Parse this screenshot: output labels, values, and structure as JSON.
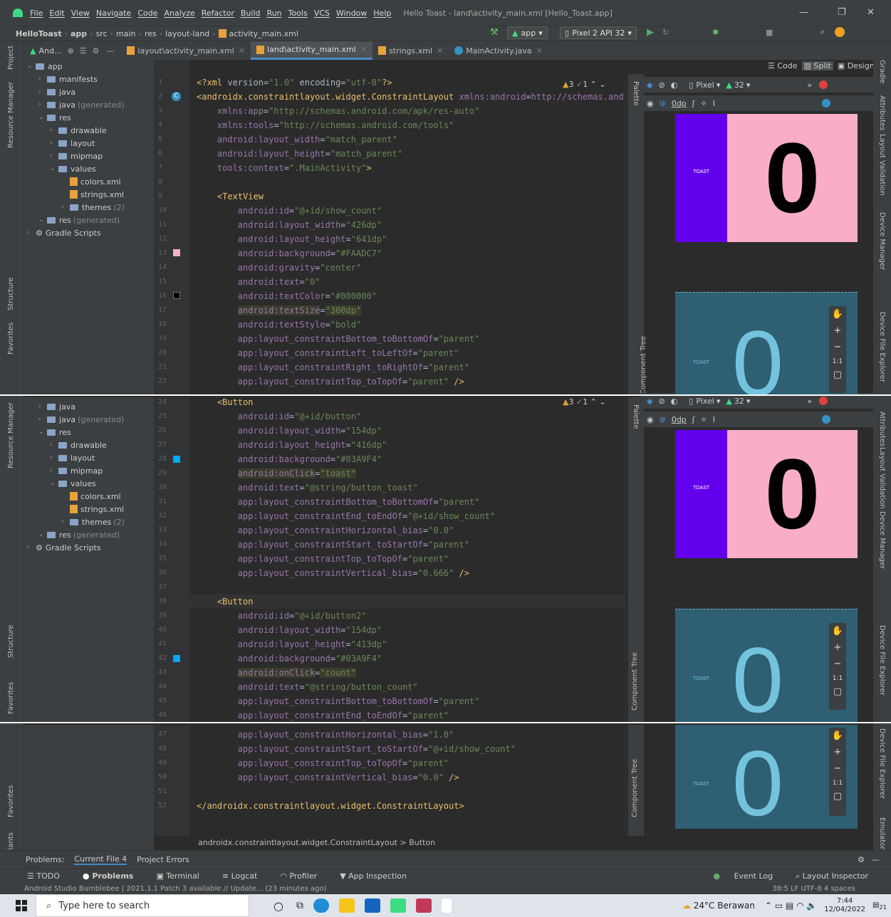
{
  "menu": {
    "items": [
      "File",
      "Edit",
      "View",
      "Navigate",
      "Code",
      "Analyze",
      "Refactor",
      "Build",
      "Run",
      "Tools",
      "VCS",
      "Window",
      "Help"
    ],
    "window_title": "Hello Toast - land\\activity_main.xml [Hello_Toast.app]"
  },
  "nav": {
    "crumbs": [
      "HelloToast",
      "app",
      "src",
      "main",
      "res",
      "layout-land",
      "activity_main.xml"
    ],
    "run_config": "app",
    "device": "Pixel 2 API 32"
  },
  "tabs": [
    "layout\\activity_main.xml",
    "land\\activity_main.xml",
    "strings.xml",
    "MainActivity.java"
  ],
  "project": {
    "header": "app",
    "view_mode": "And..."
  },
  "tree_top": [
    {
      "label": "app",
      "indent": 0
    },
    {
      "label": "manifests",
      "indent": 1
    },
    {
      "label": "java",
      "indent": 1
    },
    {
      "label": "java",
      "gen": "(generated)",
      "indent": 1
    },
    {
      "label": "res",
      "indent": 1
    },
    {
      "label": "drawable",
      "indent": 2
    },
    {
      "label": "layout",
      "indent": 2
    },
    {
      "label": "mipmap",
      "indent": 2
    },
    {
      "label": "values",
      "indent": 2
    },
    {
      "label": "colors.xml",
      "indent": 3
    },
    {
      "label": "strings.xml",
      "indent": 3
    },
    {
      "label": "themes",
      "gen": "(2)",
      "indent": 3
    },
    {
      "label": "res",
      "gen": "(generated)",
      "indent": 1
    },
    {
      "label": "Gradle Scripts",
      "indent": 0
    }
  ],
  "tree_mid": [
    {
      "label": "java",
      "indent": 1
    },
    {
      "label": "java",
      "gen": "(generated)",
      "indent": 1
    },
    {
      "label": "res",
      "indent": 1
    },
    {
      "label": "drawable",
      "indent": 2
    },
    {
      "label": "layout",
      "indent": 2
    },
    {
      "label": "mipmap",
      "indent": 2
    },
    {
      "label": "values",
      "indent": 2
    },
    {
      "label": "colors.xml",
      "indent": 3
    },
    {
      "label": "strings.xml",
      "indent": 3
    },
    {
      "label": "themes",
      "gen": "(2)",
      "indent": 3
    },
    {
      "label": "res",
      "gen": "(generated)",
      "indent": 1
    },
    {
      "label": "Gradle Scripts",
      "indent": 0
    }
  ],
  "code_top": [
    {
      "n": "1",
      "s": "<?xml version=\"1.0\" encoding=\"utf-8\"?>"
    },
    {
      "n": "2",
      "s": "<androidx.constraintlayout.widget.ConstraintLayout xmlns:android=\"http://schemas.and"
    },
    {
      "n": "3",
      "s": "    xmlns:app=\"http://schemas.android.com/apk/res-auto\""
    },
    {
      "n": "4",
      "s": "    xmlns:tools=\"http://schemas.android.com/tools\""
    },
    {
      "n": "5",
      "s": "    android:layout_width=\"match_parent\""
    },
    {
      "n": "6",
      "s": "    android:layout_height=\"match_parent\""
    },
    {
      "n": "7",
      "s": "    tools:context=\".MainActivity\">"
    },
    {
      "n": "8",
      "s": ""
    },
    {
      "n": "9",
      "s": "    <TextView"
    },
    {
      "n": "10",
      "s": "        android:id=\"@+id/show_count\""
    },
    {
      "n": "11",
      "s": "        android:layout_width=\"426dp\""
    },
    {
      "n": "12",
      "s": "        android:layout_height=\"641dp\""
    },
    {
      "n": "13",
      "s": "        android:background=\"#FAADC7\""
    },
    {
      "n": "14",
      "s": "        android:gravity=\"center\""
    },
    {
      "n": "15",
      "s": "        android:text=\"0\""
    },
    {
      "n": "16",
      "s": "        android:textColor=\"#000000\""
    },
    {
      "n": "17",
      "s": "        android:textSize=\"300dp\""
    },
    {
      "n": "18",
      "s": "        android:textStyle=\"bold\""
    },
    {
      "n": "19",
      "s": "        app:layout_constraintBottom_toBottomOf=\"parent\""
    },
    {
      "n": "20",
      "s": "        app:layout_constraintLeft_toLeftOf=\"parent\""
    },
    {
      "n": "21",
      "s": "        app:layout_constraintRight_toRightOf=\"parent\""
    },
    {
      "n": "22",
      "s": "        app:layout_constraintTop_toTopOf=\"parent\" />"
    }
  ],
  "code_mid": [
    {
      "n": "24",
      "s": "    <Button"
    },
    {
      "n": "25",
      "s": "        android:id=\"@+id/button\""
    },
    {
      "n": "26",
      "s": "        android:layout_width=\"154dp\""
    },
    {
      "n": "27",
      "s": "        android:layout_height=\"416dp\""
    },
    {
      "n": "28",
      "s": "        android:background=\"#03A9F4\""
    },
    {
      "n": "29",
      "s": "        android:onClick=\"toast\""
    },
    {
      "n": "30",
      "s": "        android:text=\"@string/button_toast\""
    },
    {
      "n": "31",
      "s": "        app:layout_constraintBottom_toBottomOf=\"parent\""
    },
    {
      "n": "32",
      "s": "        app:layout_constraintEnd_toEndOf=\"@+id/show_count\""
    },
    {
      "n": "33",
      "s": "        app:layout_constraintHorizontal_bias=\"0.0\""
    },
    {
      "n": "34",
      "s": "        app:layout_constraintStart_toStartOf=\"parent\""
    },
    {
      "n": "35",
      "s": "        app:layout_constraintTop_toTopOf=\"parent\""
    },
    {
      "n": "36",
      "s": "        app:layout_constraintVertical_bias=\"0.666\" />"
    },
    {
      "n": "37",
      "s": ""
    },
    {
      "n": "38",
      "s": "    <Button"
    },
    {
      "n": "39",
      "s": "        android:id=\"@+id/button2\""
    },
    {
      "n": "40",
      "s": "        android:layout_width=\"154dp\""
    },
    {
      "n": "41",
      "s": "        android:layout_height=\"413dp\""
    },
    {
      "n": "42",
      "s": "        android:background=\"#03A9F4\""
    },
    {
      "n": "43",
      "s": "        android:onClick=\"count\""
    },
    {
      "n": "44",
      "s": "        android:text=\"@string/button_count\""
    },
    {
      "n": "45",
      "s": "        app:layout_constraintBottom_toBottomOf=\"parent\""
    },
    {
      "n": "46",
      "s": "        app:layout_constraintEnd_toEndOf=\"parent\""
    }
  ],
  "code_bot": [
    {
      "n": "47",
      "s": "        app:layout_constraintHorizontal_bias=\"1.0\""
    },
    {
      "n": "48",
      "s": "        app:layout_constraintStart_toStartOf=\"@+id/show_count\""
    },
    {
      "n": "49",
      "s": "        app:layout_constraintTop_toTopOf=\"parent\""
    },
    {
      "n": "50",
      "s": "        app:layout_constraintVertical_bias=\"0.0\" />"
    },
    {
      "n": "51",
      "s": ""
    },
    {
      "n": "52",
      "s": "</androidx.constraintlayout.widget.ConstraintLayout>"
    }
  ],
  "breadcrumb_bottom": "androidx.constraintlayout.widget.ConstraintLayout  >  Button",
  "design": {
    "view_modes": [
      "Code",
      "Split",
      "Design"
    ],
    "device": "Pixel",
    "api": "32",
    "margin": "0dp",
    "preview_text": "0",
    "toast_label": "TOAST",
    "warnings": "3",
    "ok": "1",
    "zoom_fit": "1:1",
    "pink": "#FAADC7",
    "purple": "#6200EE",
    "blueprint": "#2E5F72"
  },
  "side_labels": {
    "project": "Project",
    "resource_manager": "Resource Manager",
    "structure": "Structure",
    "favorites": "Favorites",
    "build_variants": "Build Variants",
    "gradle": "Gradle",
    "attributes": "Attributes",
    "layout_validation": "Layout Validation",
    "device_manager": "Device Manager",
    "device_file_explorer": "Device File Explorer",
    "emulator": "Emulator",
    "palette": "Palette",
    "component_tree": "Component Tree"
  },
  "problems": {
    "label": "Problems:",
    "tabs": [
      "Current File 4",
      "Project Errors"
    ]
  },
  "tool_tabs": [
    "TODO",
    "Problems",
    "Terminal",
    "Logcat",
    "Profiler",
    "App Inspection"
  ],
  "tool_right": [
    "Event Log",
    "Layout Inspector"
  ],
  "status": {
    "message": "Android Studio Bumblebee | 2021.1.1 Patch 3 available // Update... (23 minutes ago)",
    "right": "38:5  LF  UTF-8  4 spaces"
  },
  "taskbar": {
    "search_placeholder": "Type here to search",
    "weather": "24°C  Berawan",
    "time": "7:44",
    "date": "12/04/2022",
    "notif": "21"
  }
}
